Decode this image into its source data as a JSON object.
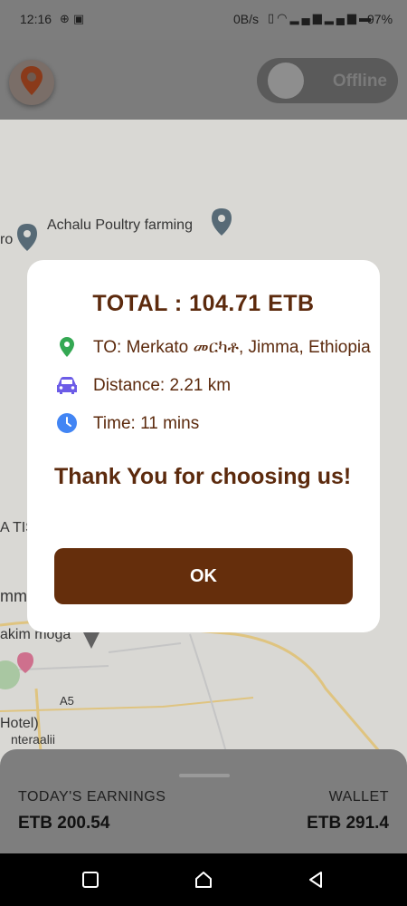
{
  "status_bar": {
    "time": "12:16",
    "speed": "0B/s",
    "battery": "97%",
    "icons": [
      "plus-circle-icon",
      "gallery-icon",
      "vibrate-icon",
      "wifi-icon",
      "signal-icon",
      "signal-icon",
      "battery-icon"
    ]
  },
  "header": {
    "toggle_label": "Offline"
  },
  "map": {
    "labels": [
      "Achalu Poultry farming",
      "ro",
      "A TIS",
      "mma",
      "akim moga",
      "A5",
      "Hotel)",
      "nteraalii"
    ]
  },
  "dialog": {
    "total": "TOTAL : 104.71 ETB",
    "destination": "TO: Merkato መርካቶ, Jimma, Ethiopia",
    "distance": "Distance: 2.21 km",
    "time": "Time:  11 mins",
    "thanks": "Thank You for choosing us!",
    "ok_label": "OK",
    "colors": {
      "accent": "#5c2a0d",
      "button": "#652e0c",
      "location_icon": "#34a853",
      "car_icon": "#6c5ce7",
      "clock_icon": "#4285f4"
    }
  },
  "bottom_card": {
    "earnings_label": "TODAY'S EARNINGS",
    "earnings_value": "ETB 200.54",
    "wallet_label": "WALLET",
    "wallet_value": "ETB 291.4"
  }
}
